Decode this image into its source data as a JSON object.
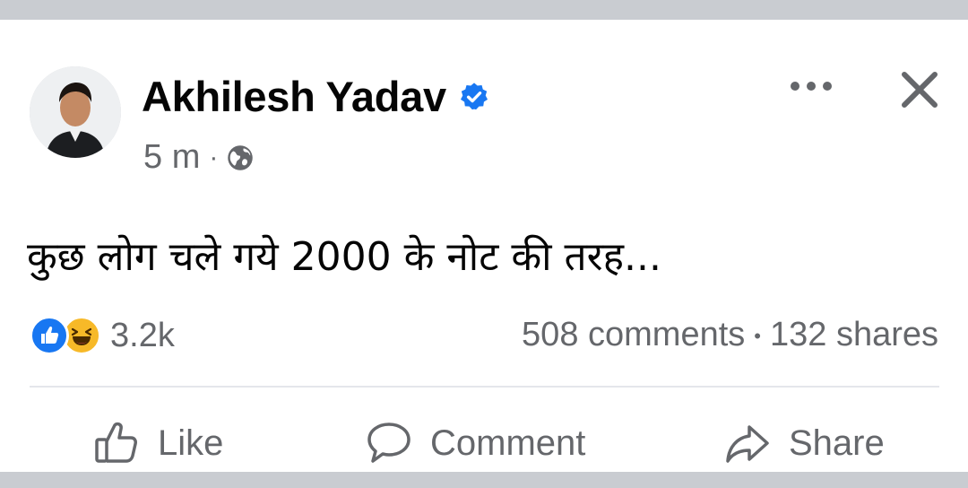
{
  "post": {
    "author": "Akhilesh Yadav",
    "time": "5 m",
    "separator": "·",
    "text": "कुछ लोग चले गये 2000 के नोट की तरह...",
    "audience_icon": "globe-icon",
    "verified_icon": "verified-badge-icon"
  },
  "engagement": {
    "reaction_icons": [
      "like-reaction-icon",
      "haha-reaction-icon"
    ],
    "reaction_count": "3.2k",
    "comments": "508 comments",
    "bullet": "•",
    "shares": "132 shares"
  },
  "actions": {
    "like_label": "Like",
    "comment_label": "Comment",
    "share_label": "Share"
  },
  "colors": {
    "brand_blue": "#1877f2",
    "haha_yellow": "#f7b928",
    "text_primary": "#050505",
    "text_secondary": "#65676b"
  }
}
